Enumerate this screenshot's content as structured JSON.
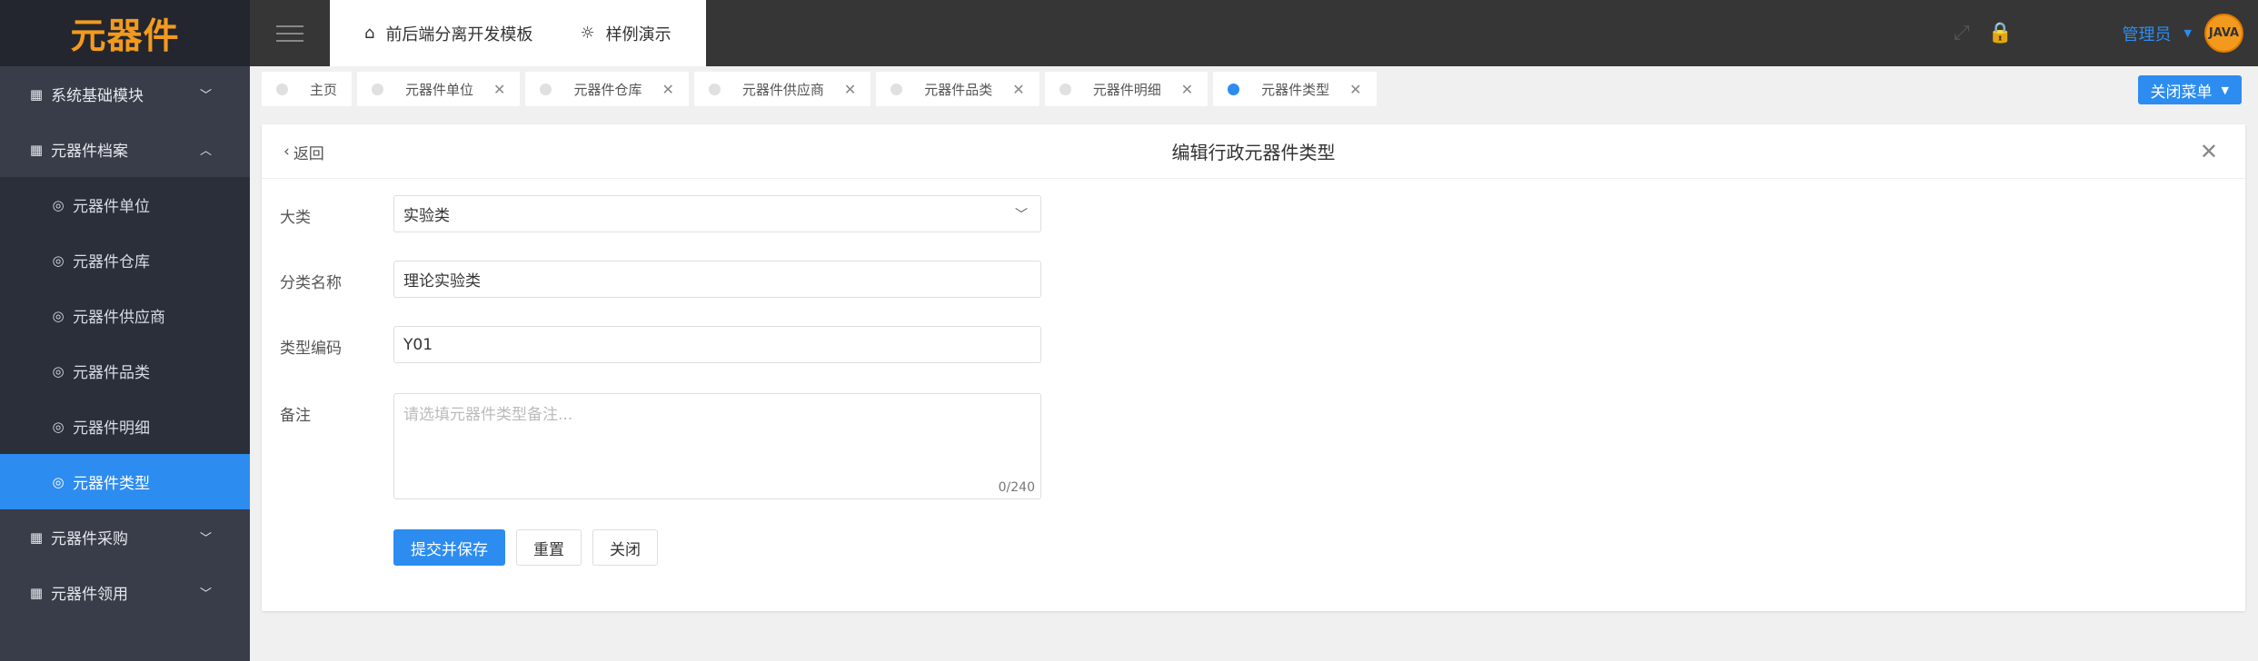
{
  "app": {
    "logo": "元器件"
  },
  "sidebar": {
    "items": [
      {
        "label": "系统基础模块",
        "icon": "dashboard-icon",
        "arrow": "⌄"
      },
      {
        "label": "元器件档案",
        "icon": "grid-icon",
        "arrow": "⌃"
      },
      {
        "label": "元器件单位",
        "icon": "target-icon"
      },
      {
        "label": "元器件仓库",
        "icon": "target-icon"
      },
      {
        "label": "元器件供应商",
        "icon": "target-icon"
      },
      {
        "label": "元器件品类",
        "icon": "target-icon"
      },
      {
        "label": "元器件明细",
        "icon": "target-icon"
      },
      {
        "label": "元器件类型",
        "icon": "target-icon"
      },
      {
        "label": "元器件采购",
        "icon": "grid-icon",
        "arrow": "⌄"
      },
      {
        "label": "元器件领用",
        "icon": "grid-icon",
        "arrow": "⌄"
      }
    ]
  },
  "header": {
    "tabs": [
      {
        "label": "前后端分离开发模板",
        "icon": "home-icon"
      },
      {
        "label": "样例演示",
        "icon": "bulb-icon"
      }
    ],
    "user": "管理员",
    "avatar_text": "JAVA"
  },
  "tabs": [
    {
      "label": "主页",
      "closable": false
    },
    {
      "label": "元器件单位",
      "closable": true
    },
    {
      "label": "元器件仓库",
      "closable": true
    },
    {
      "label": "元器件供应商",
      "closable": true
    },
    {
      "label": "元器件品类",
      "closable": true
    },
    {
      "label": "元器件明细",
      "closable": true
    },
    {
      "label": "元器件类型",
      "closable": true
    }
  ],
  "close_menu": "关闭菜单",
  "panel": {
    "back": "返回",
    "title": "编辑行政元器件类型"
  },
  "form": {
    "category_label": "大类",
    "category_value": "实验类",
    "name_label": "分类名称",
    "name_value": "理论实验类",
    "code_label": "类型编码",
    "code_value": "Y01",
    "remark_label": "备注",
    "remark_placeholder": "请选填元器件类型备注...",
    "remark_count": "0/240",
    "submit": "提交并保存",
    "reset": "重置",
    "close": "关闭"
  },
  "colors": {
    "accent": "#2d8cf0",
    "sidebar": "#393d49",
    "logo": "#f39a1e"
  }
}
